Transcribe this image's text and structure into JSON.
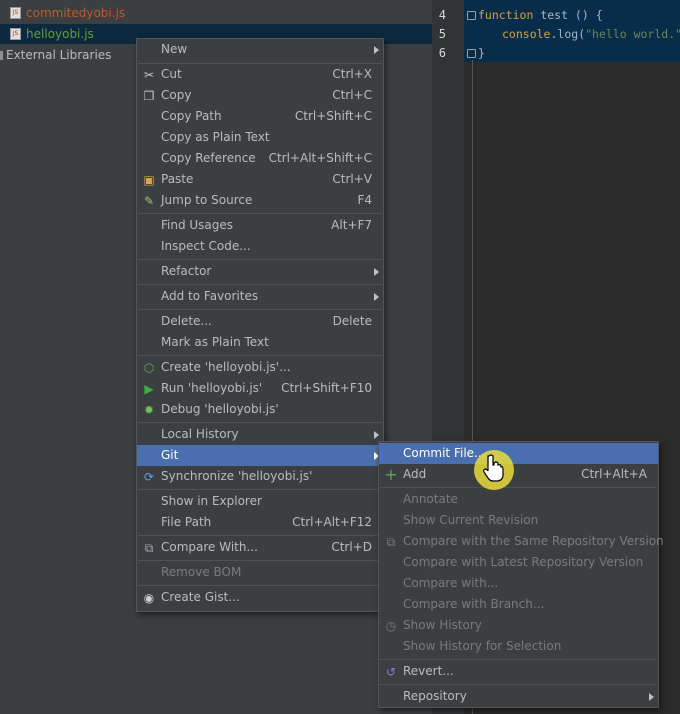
{
  "tree": {
    "rows": [
      {
        "label": "commitedyobi.js",
        "color": "#c0592b"
      },
      {
        "label": "helloyobi.js",
        "color": "#6a9a3a"
      },
      {
        "label": "External Libraries",
        "color": "#bbbbbb"
      }
    ]
  },
  "editor": {
    "line_numbers": [
      "4",
      "5",
      "6"
    ],
    "line4": {
      "kw": "function",
      "rest": " test () {"
    },
    "line5": {
      "obj": "console",
      "dot": ".",
      "meth": "log",
      "open": "(",
      "str": "\"hello world.\"",
      "close": ");"
    },
    "line6": "}"
  },
  "menu": {
    "items": [
      {
        "label": "New",
        "shortcut": ""
      },
      {
        "label": "Cut",
        "shortcut": "Ctrl+X"
      },
      {
        "label": "Copy",
        "shortcut": "Ctrl+C"
      },
      {
        "label": "Copy Path",
        "shortcut": "Ctrl+Shift+C"
      },
      {
        "label": "Copy as Plain Text",
        "shortcut": ""
      },
      {
        "label": "Copy Reference",
        "shortcut": "Ctrl+Alt+Shift+C"
      },
      {
        "label": "Paste",
        "shortcut": "Ctrl+V"
      },
      {
        "label": "Jump to Source",
        "shortcut": "F4"
      },
      {
        "label": "Find Usages",
        "shortcut": "Alt+F7"
      },
      {
        "label": "Inspect Code...",
        "shortcut": ""
      },
      {
        "label": "Refactor",
        "shortcut": ""
      },
      {
        "label": "Add to Favorites",
        "shortcut": ""
      },
      {
        "label": "Delete...",
        "shortcut": "Delete"
      },
      {
        "label": "Mark as Plain Text",
        "shortcut": ""
      },
      {
        "label": "Create 'helloyobi.js'...",
        "shortcut": ""
      },
      {
        "label": "Run 'helloyobi.js'",
        "shortcut": "Ctrl+Shift+F10"
      },
      {
        "label": "Debug 'helloyobi.js'",
        "shortcut": ""
      },
      {
        "label": "Local History",
        "shortcut": ""
      },
      {
        "label": "Git",
        "shortcut": ""
      },
      {
        "label": "Synchronize 'helloyobi.js'",
        "shortcut": ""
      },
      {
        "label": "Show in Explorer",
        "shortcut": ""
      },
      {
        "label": "File Path",
        "shortcut": "Ctrl+Alt+F12"
      },
      {
        "label": "Compare With...",
        "shortcut": "Ctrl+D"
      },
      {
        "label": "Remove BOM",
        "shortcut": ""
      },
      {
        "label": "Create Gist...",
        "shortcut": ""
      }
    ]
  },
  "git_menu": {
    "items": [
      {
        "label": "Commit File...",
        "shortcut": ""
      },
      {
        "label": "Add",
        "shortcut": "Ctrl+Alt+A"
      },
      {
        "label": "Annotate",
        "shortcut": ""
      },
      {
        "label": "Show Current Revision",
        "shortcut": ""
      },
      {
        "label": "Compare with the Same Repository Version",
        "shortcut": ""
      },
      {
        "label": "Compare with Latest Repository Version",
        "shortcut": ""
      },
      {
        "label": "Compare with...",
        "shortcut": ""
      },
      {
        "label": "Compare with Branch...",
        "shortcut": ""
      },
      {
        "label": "Show History",
        "shortcut": ""
      },
      {
        "label": "Show History for Selection",
        "shortcut": ""
      },
      {
        "label": "Revert...",
        "shortcut": ""
      },
      {
        "label": "Repository",
        "shortcut": ""
      }
    ]
  },
  "colors": {
    "highlight": "#4b6eaf",
    "menu_bg": "#3c3f41",
    "editor_bg": "#2b2b2b",
    "selected_row": "#0d293e",
    "cursor_halo": "#e6dc3c"
  },
  "icons": [
    "js-file-icon",
    "scissors-icon",
    "copy-icon",
    "paste-icon",
    "jump-to-source-icon",
    "nodejs-icon",
    "run-icon",
    "debug-icon",
    "sync-icon",
    "compare-icon",
    "github-icon",
    "plus-icon",
    "history-icon",
    "revert-icon",
    "hand-cursor-icon"
  ]
}
